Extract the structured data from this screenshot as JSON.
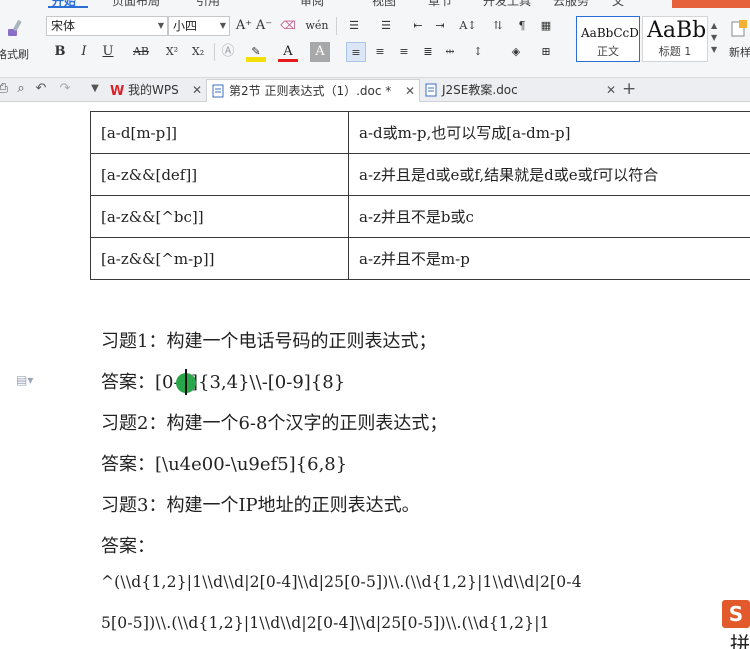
{
  "ribbon": {
    "menu_tabs": [
      "开始",
      "页面布局",
      "引用",
      "审阅",
      "视图",
      "章节",
      "开发工具",
      "云服务",
      "文"
    ],
    "format_painter_label": "格式刷",
    "font_name": "宋体",
    "font_size": "小四",
    "styles": [
      {
        "preview": "AaBbCcDd",
        "caption": "正文"
      },
      {
        "preview": "AaBb",
        "caption": "标题 1"
      }
    ],
    "new_style_label": "新样",
    "toolbar_glyphs": {
      "grow_font": "A⁺",
      "shrink_font": "A⁻",
      "clear_format": "⌫",
      "pinyin": "wén",
      "bold": "B",
      "italic": "I",
      "underline": "U",
      "strikethrough": "AB",
      "superscript": "X²",
      "subscript": "X₂",
      "font_color": "A",
      "char_shading": "A"
    },
    "accent_color": "#2b6ed6"
  },
  "tabs": [
    {
      "label": "我的WPS",
      "icon": "wps-logo-icon",
      "active": false
    },
    {
      "label": "第2节 正则表达式（1）.doc *",
      "icon": "doc-icon",
      "active": true
    },
    {
      "label": "J2SE教案.doc",
      "icon": "doc-icon",
      "active": false
    }
  ],
  "table": {
    "rows": [
      [
        "[a-d[m-p]]",
        "a-d或m-p,也可以写成[a-dm-p]"
      ],
      [
        "[a-z&&[def]]",
        "a-z并且是d或e或f,结果就是d或e或f可以符合"
      ],
      [
        "[a-z&&[^bc]]",
        "a-z并且不是b或c"
      ],
      [
        "[a-z&&[^m-p]]",
        "a-z并且不是m-p"
      ]
    ]
  },
  "paragraphs": {
    "q1": "习题1：构建一个电话号码的正则表达式；",
    "a1": "答案：[0-9]{3,4}\\\\-[0-9]{8}",
    "q2": "习题2：构建一个6-8个汉字的正则表达式；",
    "a2": "答案：[\\u4e00-\\u9ef5]{6,8}",
    "q3": "习题3：构建一个IP地址的正则表达式。",
    "a3": "答案：",
    "code1": "^(\\\\d{1,2}|1\\\\d\\\\d|2[0-4]\\\\d|25[0-5])\\\\.(\\\\d{1,2}|1\\\\d\\\\d|2[0-4",
    "code2": "5[0-5])\\\\.(\\\\d{1,2}|1\\\\d\\\\d|2[0-4]\\\\d|25[0-5])\\\\.(\\\\d{1,2}|1"
  },
  "ime": {
    "logo": "S",
    "char": "拼"
  }
}
